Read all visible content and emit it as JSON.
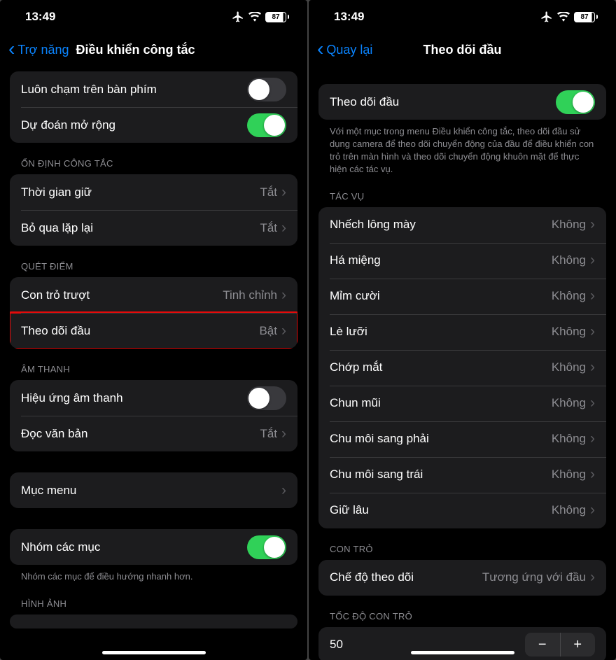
{
  "status": {
    "time": "13:49",
    "battery": "87"
  },
  "left": {
    "back": "Trợ năng",
    "title": "Điều khiển công tắc",
    "group_top": [
      {
        "label": "Luôn chạm trên bàn phím",
        "toggle": false
      },
      {
        "label": "Dự đoán mở rộng",
        "toggle": true
      }
    ],
    "sec_stability": {
      "header": "ỔN ĐỊNH CÔNG TẮC",
      "rows": [
        {
          "label": "Thời gian giữ",
          "value": "Tắt"
        },
        {
          "label": "Bỏ qua lặp lại",
          "value": "Tắt"
        }
      ]
    },
    "sec_scan": {
      "header": "QUÉT ĐIỂM",
      "rows": [
        {
          "label": "Con trỏ trượt",
          "value": "Tinh chỉnh"
        },
        {
          "label": "Theo dõi đầu",
          "value": "Bật",
          "highlight": true
        }
      ]
    },
    "sec_audio": {
      "header": "ÂM THANH",
      "rows": [
        {
          "label": "Hiệu ứng âm thanh",
          "toggle": false
        },
        {
          "label": "Đọc văn bản",
          "value": "Tắt"
        }
      ]
    },
    "menu_row": {
      "label": "Mục menu"
    },
    "group_items": {
      "label": "Nhóm các mục",
      "toggle": true,
      "footer": "Nhóm các mục để điều hướng nhanh hơn."
    },
    "sec_image_header": "HÌNH ẢNH"
  },
  "right": {
    "back": "Quay lại",
    "title": "Theo dõi đầu",
    "main_toggle": {
      "label": "Theo dõi đầu",
      "toggle": true
    },
    "main_footer": "Với một mục trong menu Điều khiển công tắc, theo dõi đầu sử dụng camera để theo dõi chuyển động của đầu để điều khiển con trỏ trên màn hình và theo dõi chuyển động khuôn mặt để thực hiện các tác vụ.",
    "sec_actions": {
      "header": "TÁC VỤ",
      "rows": [
        {
          "label": "Nhếch lông mày",
          "value": "Không"
        },
        {
          "label": "Há miệng",
          "value": "Không"
        },
        {
          "label": "Mỉm cười",
          "value": "Không"
        },
        {
          "label": "Lè lưỡi",
          "value": "Không"
        },
        {
          "label": "Chớp mắt",
          "value": "Không"
        },
        {
          "label": "Chun mũi",
          "value": "Không"
        },
        {
          "label": "Chu môi sang phải",
          "value": "Không"
        },
        {
          "label": "Chu môi sang trái",
          "value": "Không"
        },
        {
          "label": "Giữ lâu",
          "value": "Không"
        }
      ]
    },
    "sec_pointer": {
      "header": "CON TRỎ",
      "row": {
        "label": "Chế độ theo dõi",
        "value": "Tương ứng với đầu"
      }
    },
    "sec_speed": {
      "header": "TỐC ĐỘ CON TRỎ",
      "value": "50"
    }
  }
}
